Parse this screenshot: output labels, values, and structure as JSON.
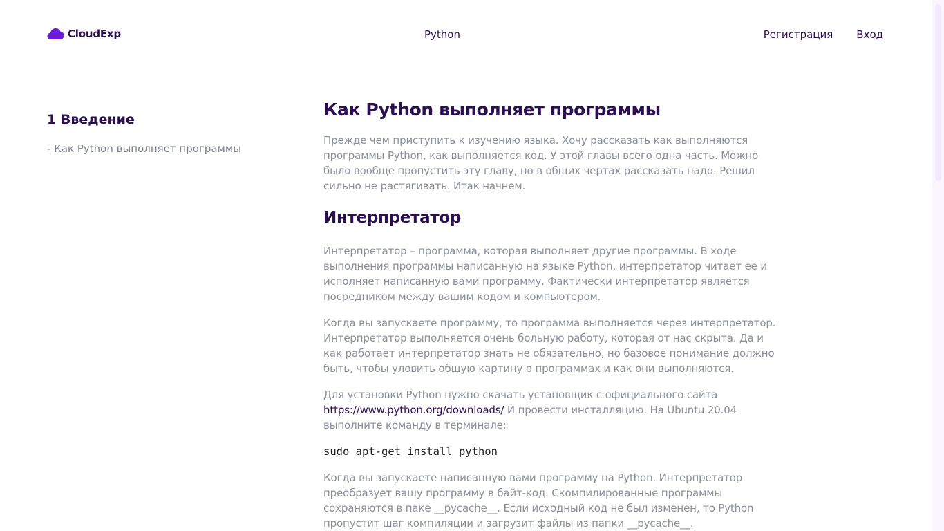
{
  "header": {
    "brand": "CloudExp",
    "nav_center": "Python",
    "register": "Регистрация",
    "login": "Вход"
  },
  "sidebar": {
    "section_title": "1 Введение",
    "items": [
      {
        "label": "- Как Python выполняет программы"
      }
    ]
  },
  "article": {
    "title": "Как Python выполняет программы",
    "intro": "Прежде чем приступить к изучению языка. Хочу рассказать как выполняются программы Python, как выполняется код. У этой главы всего одна часть. Можно было вообще пропустить эту главу, но в общих чертах рассказать надо. Решил сильно не растягивать. Итак начнем.",
    "section_title": "Интерпретатор",
    "para1": "Интерпретатор – программа, которая выполняет другие программы. В ходе выполнения программы написанную на языке Python, интерпретатор читает ее и исполняет написанную вами программу. Фактически интерпретатор является посредником между вашим кодом и компьютером.",
    "para2": "Когда вы запускаете программу, то программа выполняется через интерпретатор. Интерпретатор выполняется очень больную работу, которая от нас скрыта. Да и как работает интерпретатор знать не обязательно, но базовое понимание должно быть, чтобы уловить общую картину о программах и как они выполняются.",
    "para3_before": "Для установки Python нужно скачать установщик с официального сайта",
    "para3_link": "https://www.python.org/downloads/",
    "para3_after": " И провести инсталляцию. На Ubuntu 20.04 выполните команду в терминале:",
    "code": "sudo apt-get install python",
    "para4": "Когда вы запускаете написанную вами программу на Python. Интерпретатор преобразует вашу программу в байт-код. Скомпилированные программы сохраняются в паке __pycache__. Если исходный код не был изменен, то Python пропустит шаг компиляции и загрузит файлы из папки __pycache__."
  },
  "colors": {
    "brand": "#2b0f4f",
    "logo_icon": "#6a1bd4",
    "muted_text": "#8a8f99"
  }
}
